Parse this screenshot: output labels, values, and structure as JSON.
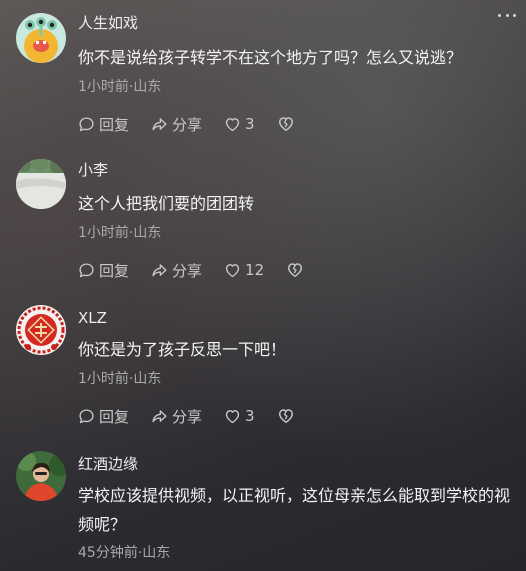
{
  "comments": [
    {
      "name": "人生如戏",
      "text": "你不是说给孩子转学不在这个地方了吗？怎么又说逃？",
      "meta": "1小时前·山东",
      "reply_label": "回复",
      "share_label": "分享",
      "likes": "3",
      "avatar_icon": "green-cartoon-monster-avatar"
    },
    {
      "name": "小李",
      "text": "这个人把我们要的团团转",
      "meta": "1小时前·山东",
      "reply_label": "回复",
      "share_label": "分享",
      "likes": "12",
      "avatar_icon": "snowy-tree-photo-avatar"
    },
    {
      "name": "XLZ",
      "text": "你还是为了孩子反思一下吧！",
      "meta": "1小时前·山东",
      "reply_label": "回复",
      "share_label": "分享",
      "likes": "3",
      "avatar_icon": "red-chinese-emblem-avatar"
    },
    {
      "name": "红酒边缘",
      "text": "学校应该提供视频，以正视听，这位母亲怎么能取到学校的视频呢？",
      "meta": "45分钟前·山东",
      "avatar_icon": "person-in-red-avatar"
    }
  ],
  "colors": {
    "text": "#f4f4f4",
    "meta": "#a9a9a9",
    "action": "#c8c8c8"
  }
}
